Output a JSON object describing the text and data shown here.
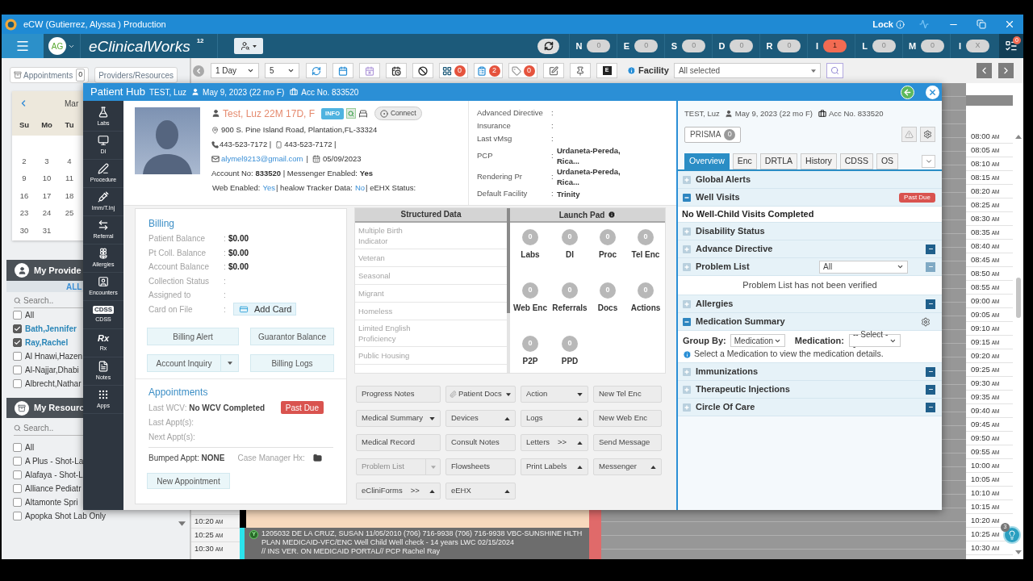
{
  "title_bar": {
    "title": "eCW (Gutierrez, Alyssa ) Production",
    "lock_label": "Lock"
  },
  "nav_bar": {
    "avatar": "AG",
    "brand": "eClinicalWorks",
    "version": "12",
    "counters": [
      {
        "letter": "N",
        "count": "0",
        "alert": false
      },
      {
        "letter": "E",
        "count": "0",
        "alert": false
      },
      {
        "letter": "S",
        "count": "0",
        "alert": false
      },
      {
        "letter": "D",
        "count": "0",
        "alert": false
      },
      {
        "letter": "R",
        "count": "0",
        "alert": false
      },
      {
        "letter": "I",
        "count": "1",
        "alert": true
      },
      {
        "letter": "L",
        "count": "0",
        "alert": false
      },
      {
        "letter": "M",
        "count": "0",
        "alert": false
      },
      {
        "letter": "I",
        "count": "X",
        "alert": false
      }
    ],
    "menu_badge": "0"
  },
  "left_panel": {
    "buttons": [
      {
        "label": "Appointments",
        "count": "0",
        "kind": "appointments"
      },
      {
        "label": "Providers/Resources",
        "kind": "plain"
      }
    ],
    "calendar": {
      "month": "Mar",
      "weekdays": [
        "Su",
        "Mo",
        "Tu"
      ],
      "weeks": [
        [
          "2",
          "3",
          "4"
        ],
        [
          "9",
          "10",
          "11"
        ],
        [
          "16",
          "17",
          "18"
        ],
        [
          "23",
          "24",
          "25"
        ],
        [
          "30",
          "31"
        ]
      ]
    },
    "providers": {
      "title": "My Provide",
      "filter": "ALL",
      "search_placeholder": "Search..",
      "items": [
        {
          "label": "All",
          "checked": false
        },
        {
          "label": "Bath,Jennifer",
          "checked": true
        },
        {
          "label": "Ray,Rachel",
          "checked": true
        },
        {
          "label": "Al Hnawi,Hazen",
          "checked": false
        },
        {
          "label": "Al-Najjar,Dhabi",
          "checked": false
        },
        {
          "label": "Albrecht,Nathar",
          "checked": false
        }
      ]
    },
    "resources": {
      "title": "My Resourc",
      "search_placeholder": "Search..",
      "items": [
        {
          "label": "All",
          "checked": false
        },
        {
          "label": "A Plus - Shot-La",
          "checked": false
        },
        {
          "label": "Alafaya - Shot-L",
          "checked": false
        },
        {
          "label": "Alliance Pediatr",
          "checked": false
        },
        {
          "label": "Altamonte Spri",
          "checked": false
        },
        {
          "label": "Apopka Shot Lab Only",
          "checked": false
        }
      ]
    }
  },
  "scheduler": {
    "view": "1 Day",
    "count": "5",
    "tools": [
      {
        "kind": "icon"
      },
      {
        "kind": "icon"
      },
      {
        "kind": "icon"
      },
      {
        "kind": "icon"
      },
      {
        "kind": "icon"
      },
      {
        "kind": "counter",
        "badge": "0"
      },
      {
        "kind": "counter",
        "badge": "2"
      },
      {
        "kind": "counter",
        "badge": "0"
      },
      {
        "kind": "icon"
      },
      {
        "kind": "icon"
      },
      {
        "kind": "letter",
        "text": "E"
      }
    ],
    "facility_label": "Facility",
    "facility_value": "All selected",
    "left_times": [
      {
        "time": "10:20",
        "period": "AM"
      },
      {
        "time": "10:25",
        "period": "AM"
      },
      {
        "time": "10:30",
        "period": "AM"
      }
    ],
    "appointment": {
      "status": "Y",
      "lines": [
        "1205032 DE LA CRUZ, SUSAN 11/05/2010 (706) 716-9938 (706) 716-9938 VBC-SUNSHINE HLTH",
        "PLAN MEDICAID-VFC/ENC Well Child Well check - 14 years LWC 02/15/2024",
        "// INS VER. ON MEDICAID PORTAL// PCP Rachel Ray"
      ]
    },
    "right_times": [
      {
        "time": "08:00",
        "period": "AM"
      },
      {
        "time": "08:05",
        "period": "AM"
      },
      {
        "time": "08:10",
        "period": "AM"
      },
      {
        "time": "08:15",
        "period": "AM"
      },
      {
        "time": "08:20",
        "period": "AM"
      },
      {
        "time": "08:25",
        "period": "AM"
      },
      {
        "time": "08:30",
        "period": "AM"
      },
      {
        "time": "08:35",
        "period": "AM"
      },
      {
        "time": "08:40",
        "period": "AM"
      },
      {
        "time": "08:45",
        "period": "AM"
      },
      {
        "time": "08:50",
        "period": "AM"
      },
      {
        "time": "08:55",
        "period": "AM"
      },
      {
        "time": "09:00",
        "period": "AM"
      },
      {
        "time": "09:05",
        "period": "AM"
      },
      {
        "time": "09:10",
        "period": "AM"
      },
      {
        "time": "09:15",
        "period": "AM"
      },
      {
        "time": "09:20",
        "period": "AM"
      },
      {
        "time": "09:25",
        "period": "AM"
      },
      {
        "time": "09:30",
        "period": "AM"
      },
      {
        "time": "09:35",
        "period": "AM"
      },
      {
        "time": "09:40",
        "period": "AM"
      },
      {
        "time": "09:45",
        "period": "AM"
      },
      {
        "time": "09:50",
        "period": "AM"
      },
      {
        "time": "09:55",
        "period": "AM"
      },
      {
        "time": "10:00",
        "period": "AM"
      },
      {
        "time": "10:05",
        "period": "AM"
      },
      {
        "time": "10:10",
        "period": "AM"
      },
      {
        "time": "10:15",
        "period": "AM"
      },
      {
        "time": "10:20",
        "period": "AM"
      },
      {
        "time": "10:25",
        "period": "AM"
      },
      {
        "time": "10:30",
        "period": "AM"
      }
    ],
    "assistant_badge": "3"
  },
  "patient_hub": {
    "title": "Patient Hub",
    "patient": "TEST, Luz",
    "dob": "May 9, 2023 (22 mo F)",
    "account": "Acc No. 833520",
    "nav": [
      {
        "label": "Labs"
      },
      {
        "label": "DI"
      },
      {
        "label": "Procedure"
      },
      {
        "label": "Imm/T.Inj"
      },
      {
        "label": "Referral"
      },
      {
        "label": "Allergies"
      },
      {
        "label": "Encounters"
      },
      {
        "label": "CDSS",
        "icon_text": "CDSS"
      },
      {
        "label": "Rx",
        "icon_text": "Rx"
      },
      {
        "label": "Notes"
      },
      {
        "label": "Apps"
      }
    ],
    "patient_info": {
      "name": "Test, Luz 22M 17D, F",
      "info_badge": "INFO",
      "connect": "Connect",
      "address": "900 S. Pine Island Road, Plantation,FL-33324",
      "phone": "443-523-7172 |",
      "mobile": "443-523-7172 |",
      "email": "alymel9213@gmail.com",
      "email_sep": "|",
      "dob": "05/09/2023",
      "account_line": "Account No: **833520** | Messenger Enabled: **Yes**",
      "status_line": [
        {
          "text": "Web Enabled:",
          "kind": "label"
        },
        {
          "text": "Yes",
          "kind": "value"
        },
        {
          "text": "| healow Tracker Data:",
          "kind": "label"
        },
        {
          "text": "No",
          "kind": "value"
        },
        {
          "text": "| eEHX Status:",
          "kind": "label"
        }
      ]
    },
    "details": [
      {
        "label": "Advanced Directive",
        "colon": ":"
      },
      {
        "label": "Insurance",
        "colon": ":"
      },
      {
        "label": "Last vMsg",
        "colon": ":"
      },
      {
        "label": "PCP",
        "colon": ":",
        "value": "Urdaneta-Pereda, Rica..."
      },
      {
        "label": "Rendering Pr",
        "colon": ":",
        "value": "Urdaneta-Pereda, Rica..."
      },
      {
        "label": "Default Facility",
        "colon": ":",
        "value": "Trinity"
      }
    ],
    "billing": {
      "title": "Billing",
      "rows": [
        {
          "label": "Patient Balance",
          "colon": ":",
          "value": "$0.00"
        },
        {
          "label": "Pt Coll. Balance",
          "colon": ":",
          "value": "$0.00"
        },
        {
          "label": "Account Balance",
          "colon": ":",
          "value": "$0.00"
        },
        {
          "label": "Collection Status",
          "colon": ":"
        },
        {
          "label": "Assigned to",
          "colon": ":"
        },
        {
          "label": "Card on File",
          "colon": ":",
          "action": "Add Card"
        }
      ],
      "buttons": [
        {
          "label": "Billing Alert",
          "kind": "plain"
        },
        {
          "label": "Guarantor Balance",
          "kind": "plain"
        },
        {
          "label": "Account Inquiry",
          "kind": "split"
        },
        {
          "label": "Billing Logs",
          "kind": "plain"
        }
      ]
    },
    "appointments": {
      "title": "Appointments",
      "last_wcv": "Last WCV: **No WCV Completed**",
      "badge": "Past Due",
      "rows": [
        "Last Appt(s):",
        "Next Appt(s):"
      ],
      "bumped": "Bumped Appt: **NONE**",
      "case_manager": "Case Manager Hx:",
      "new_button": "New Appointment"
    },
    "structured_data": {
      "title": "Structured Data",
      "items": [
        "Multiple Birth Indicator",
        "Veteran",
        "Seasonal",
        "Migrant",
        "Homeless",
        "Limited English Proficiency",
        "Public Housing"
      ]
    },
    "launch_pad": {
      "title": "Launch Pad",
      "items": [
        {
          "label": "Labs",
          "count": "0"
        },
        {
          "label": "DI",
          "count": "0"
        },
        {
          "label": "Proc",
          "count": "0"
        },
        {
          "label": "Tel Enc",
          "count": "0"
        },
        {
          "label": "Web Enc",
          "count": "0"
        },
        {
          "label": "Referrals",
          "count": "0"
        },
        {
          "label": "Docs",
          "count": "0"
        },
        {
          "label": "Actions",
          "count": "0"
        },
        {
          "label": "P2P",
          "count": "0"
        },
        {
          "label": "PPD",
          "count": "0"
        }
      ]
    },
    "actions": [
      {
        "label": "Progress Notes",
        "kind": "plain",
        "disabled": false
      },
      {
        "label": "Patient Docs",
        "kind": "attach_menu",
        "disabled": false
      },
      {
        "label": "Action",
        "kind": "menu_down",
        "disabled": false
      },
      {
        "label": "New Tel Enc",
        "kind": "plain",
        "disabled": false
      },
      {
        "label": "Medical Summary",
        "kind": "menu_down",
        "disabled": false
      },
      {
        "label": "Devices",
        "kind": "menu_up",
        "disabled": false
      },
      {
        "label": "Logs",
        "kind": "menu_up",
        "disabled": false
      },
      {
        "label": "New Web Enc",
        "kind": "plain",
        "disabled": false
      },
      {
        "label": "Medical Record",
        "kind": "plain",
        "disabled": false
      },
      {
        "label": "Consult Notes",
        "kind": "plain",
        "disabled": false
      },
      {
        "label": "Letters",
        "suffix": ">>",
        "kind": "menu_up",
        "disabled": false
      },
      {
        "label": "Send Message",
        "kind": "plain",
        "disabled": false
      },
      {
        "label": "Problem List",
        "kind": "split",
        "disabled": true
      },
      {
        "label": "Flowsheets",
        "kind": "plain",
        "disabled": false
      },
      {
        "label": "Print Labels",
        "kind": "menu_up",
        "disabled": false
      },
      {
        "label": "Messenger",
        "kind": "menu_up",
        "disabled": false
      },
      {
        "label": "eCliniForms",
        "suffix": ">>",
        "kind": "menu_up",
        "disabled": false
      },
      {
        "label": "eEHX",
        "kind": "menu_up",
        "disabled": false
      }
    ]
  },
  "overview_panel": {
    "patient": "TEST, Luz",
    "dob": "May 9, 2023 (22 mo F)",
    "account": "Acc No. 833520",
    "prisma": "PRISMA",
    "prisma_count": "0",
    "tabs": [
      {
        "label": "Overview",
        "selected": true
      },
      {
        "label": "Enc",
        "selected": false
      },
      {
        "label": "DRTLA",
        "selected": false
      },
      {
        "label": "History",
        "selected": false
      },
      {
        "label": "CDSS",
        "selected": false
      },
      {
        "label": "OS",
        "selected": false
      }
    ],
    "sections": [
      {
        "title": "Global Alerts",
        "expanded": false
      },
      {
        "title": "Well Visits",
        "expanded": true,
        "badge": "Past Due",
        "content": {
          "kind": "summary",
          "text": "No Well-Child Visits Completed"
        }
      },
      {
        "title": "Disability Status",
        "expanded": false
      },
      {
        "title": "Advance Directive",
        "expanded": false,
        "action": {
          "disabled": false
        }
      },
      {
        "title": "Problem List",
        "expanded": false,
        "filter": "All",
        "action": {
          "disabled": true
        },
        "content": {
          "kind": "notice",
          "text": "Problem List has not been verified"
        }
      },
      {
        "title": "Allergies",
        "expanded": false,
        "action": {
          "disabled": false
        }
      },
      {
        "title": "Medication Summary",
        "expanded": true,
        "settings": true,
        "content": {
          "kind": "medication",
          "group_label": "Group By:",
          "group_value": "Medication",
          "medication_label": "Medication:",
          "medication_value": "-- Select --",
          "hint": "Select a Medication to view the medication details."
        }
      },
      {
        "title": "Immunizations",
        "expanded": false,
        "action": {
          "disabled": false
        }
      },
      {
        "title": "Therapeutic Injections",
        "expanded": false,
        "action": {
          "disabled": false
        }
      },
      {
        "title": "Circle Of Care",
        "expanded": false,
        "action": {
          "disabled": false
        }
      }
    ]
  }
}
